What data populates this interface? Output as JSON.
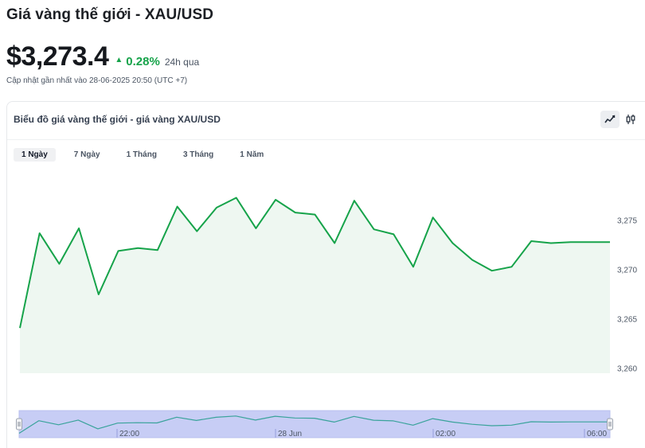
{
  "header": {
    "title": "Giá vàng thế giới - XAU/USD",
    "price": "$3,273.4",
    "change_percent": "0.28%",
    "change_period": "24h qua",
    "updated": "Cập nhật gần nhất vào 28-06-2025 20:50 (UTC +7)"
  },
  "card": {
    "title": "Biểu đồ giá vàng thế giới - giá vàng XAU/USD",
    "chart_type_buttons": [
      "line-chart-icon",
      "candlestick-icon"
    ],
    "active_chart_type": "line-chart-icon"
  },
  "tabs": [
    {
      "label": "1 Ngày",
      "active": true
    },
    {
      "label": "7 Ngày",
      "active": false
    },
    {
      "label": "1 Tháng",
      "active": false
    },
    {
      "label": "3 Tháng",
      "active": false
    },
    {
      "label": "1 Năm",
      "active": false
    }
  ],
  "colors": {
    "line": "#16a34a",
    "fill": "#eef7f1",
    "navigator_fill": "#c7cdf5",
    "navigator_line": "#3aa39b",
    "up": "#16a34a"
  },
  "chart_data": {
    "type": "area",
    "y_ticks": [
      "3,260",
      "3,265",
      "3,270",
      "3,275"
    ],
    "ylim": [
      3259.6,
      3277.2
    ],
    "values": [
      3264.1,
      3273.7,
      3270.6,
      3274.2,
      3267.5,
      3271.9,
      3272.2,
      3272.0,
      3276.4,
      3273.9,
      3276.3,
      3277.3,
      3274.2,
      3277.1,
      3275.8,
      3275.6,
      3272.7,
      3277.0,
      3274.1,
      3273.6,
      3270.3,
      3275.3,
      3272.7,
      3271.0,
      3269.9,
      3270.3,
      3272.9,
      3272.7,
      3272.8,
      3272.8,
      3272.8
    ],
    "navigator": {
      "x_labels": [
        "22:00",
        "28 Jun",
        "02:00",
        "06:00"
      ]
    }
  }
}
